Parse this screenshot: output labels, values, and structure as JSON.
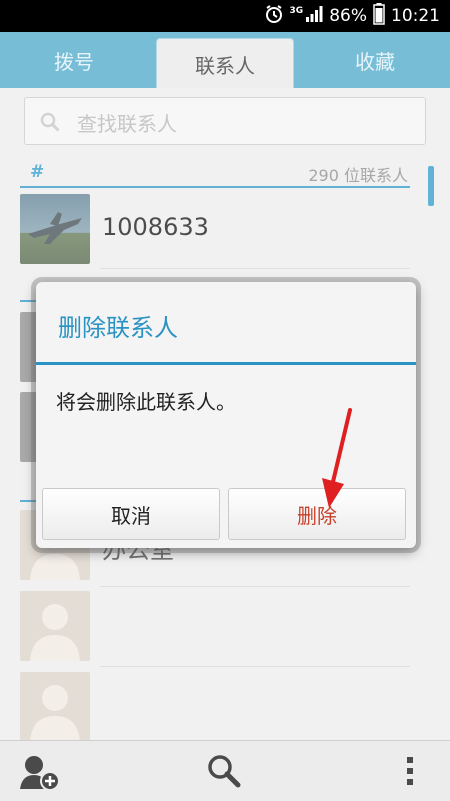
{
  "status_bar": {
    "network": "3G",
    "battery": "86%",
    "time": "10:21"
  },
  "tabs": [
    {
      "label": "拨号"
    },
    {
      "label": "联系人"
    },
    {
      "label": "收藏"
    }
  ],
  "search": {
    "placeholder": "查找联系人"
  },
  "list": {
    "section_letter": "#",
    "contact_count": "290 位联系人",
    "contacts": [
      {
        "name": "1008633"
      },
      {
        "name": "办公室"
      }
    ]
  },
  "dialog": {
    "title": "删除联系人",
    "message": "将会删除此联系人。",
    "cancel_label": "取消",
    "delete_label": "删除"
  },
  "bottom_bar": {
    "icons": [
      "add-contact-icon",
      "search-icon",
      "overflow-menu-icon"
    ]
  },
  "colors": {
    "accent": "#2a93c3",
    "tab_bar": "#4aa7c9",
    "danger": "#c8402a",
    "arrow": "#e02020"
  }
}
